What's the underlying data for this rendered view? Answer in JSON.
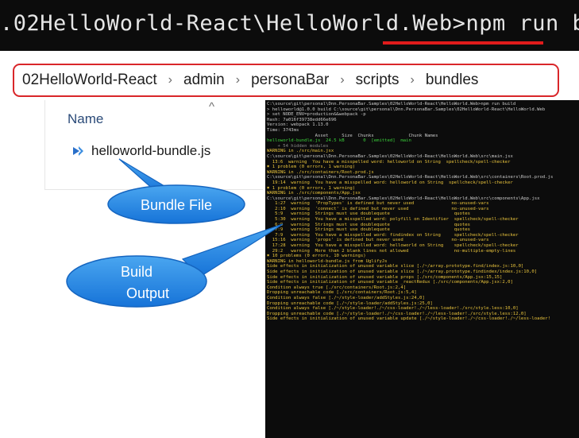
{
  "command": {
    "path": ".02HelloWorld-React\\HelloWorld.Web>",
    "cmd": "npm run build"
  },
  "breadcrumb": [
    "02HelloWorld-React",
    "admin",
    "personaBar",
    "scripts",
    "bundles"
  ],
  "breadcrumb_separator": "›",
  "explorer": {
    "column_header": "Name",
    "sort_caret": "^",
    "file_name": "helloworld-bundle.js"
  },
  "callouts": {
    "bundle_file": "Bundle File",
    "build_output_line1": "Build",
    "build_output_line2": "Output"
  },
  "colors": {
    "callout_fill": "#1e88e5",
    "highlight_red": "#d9262a",
    "terminal_bg": "#0c0c0c"
  },
  "terminal_lines": [
    {
      "t": "C:\\source\\git\\personal\\Dnn.PersonaBar.Samples\\02HelloWorld-React\\HelloWorld.Web>npm run build",
      "c": "w"
    },
    {
      "t": "",
      "c": "w"
    },
    {
      "t": "> helloworld@1.0.0 build C:\\source\\git\\personal\\Dnn.PersonaBar.Samples\\02HelloWorld-React\\HelloWorld.Web",
      "c": "w"
    },
    {
      "t": "> set NODE_ENV=production&&webpack -p",
      "c": "w"
    },
    {
      "t": "",
      "c": "w"
    },
    {
      "t": "Hash: 7a016f39738edd66e696",
      "c": "w"
    },
    {
      "t": "Version: webpack 1.13.0",
      "c": "w"
    },
    {
      "t": "Time: 3743ms",
      "c": "w"
    },
    {
      "t": "                  Asset     Size  Chunks             Chunk Names",
      "c": "w"
    },
    {
      "t": "helloworld-bundle.js  24.5 kB       0  [emitted]  main",
      "c": "g"
    },
    {
      "t": "    + 54 hidden modules",
      "c": "gr"
    },
    {
      "t": "",
      "c": "w"
    },
    {
      "t": "WARNING in ./src/main.jsx",
      "c": "y"
    },
    {
      "t": "",
      "c": "w"
    },
    {
      "t": "C:\\source\\git\\personal\\Dnn.PersonaBar.Samples\\02HelloWorld-React\\HelloWorld.Web\\src\\main.jsx",
      "c": "w"
    },
    {
      "t": "  13:6  warning  You have a misspelled word: helloworld on String  spellcheck/spell-checker",
      "c": "y"
    },
    {
      "t": "",
      "c": "w"
    },
    {
      "t": "✖ 1 problem (0 errors, 1 warning)",
      "c": "y"
    },
    {
      "t": "",
      "c": "w"
    },
    {
      "t": "",
      "c": "w"
    },
    {
      "t": "WARNING in ./src/containers/Root.prod.js",
      "c": "y"
    },
    {
      "t": "",
      "c": "w"
    },
    {
      "t": "C:\\source\\git\\personal\\Dnn.PersonaBar.Samples\\02HelloWorld-React\\HelloWorld.Web\\src\\containers\\Root.prod.js",
      "c": "w"
    },
    {
      "t": "  19:14  warning  You have a misspelled word: helloworld on String  spellcheck/spell-checker",
      "c": "y"
    },
    {
      "t": "",
      "c": "w"
    },
    {
      "t": "✖ 1 problem (0 errors, 1 warning)",
      "c": "y"
    },
    {
      "t": "",
      "c": "w"
    },
    {
      "t": "",
      "c": "w"
    },
    {
      "t": "WARNING in ./src/components/App.jsx",
      "c": "y"
    },
    {
      "t": "",
      "c": "w"
    },
    {
      "t": "C:\\source\\git\\personal\\Dnn.PersonaBar.Samples\\02HelloWorld-React\\HelloWorld.Web\\src\\components\\App.jsx",
      "c": "w"
    },
    {
      "t": "   1:27  warning  'PropTypes' is defined but never used              no-unused-vars",
      "c": "y"
    },
    {
      "t": "   2:10  warning  'connect' is defined but never used                no-unused-vars",
      "c": "y"
    },
    {
      "t": "   5:9   warning  Strings must use doublequote                        quotes",
      "c": "y"
    },
    {
      "t": "   5:30  warning  You have a misspelled word: polyfill on Identifier  spellcheck/spell-checker",
      "c": "y"
    },
    {
      "t": "   6:9   warning  Strings must use doublequote                        quotes",
      "c": "y"
    },
    {
      "t": "   7:9   warning  Strings must use doublequote                        quotes",
      "c": "y"
    },
    {
      "t": "   7:9   warning  You have a misspelled word: findindex on String     spellcheck/spell-checker",
      "c": "y"
    },
    {
      "t": "  15:16  warning  'props' is defined but never used                  no-unused-vars",
      "c": "y"
    },
    {
      "t": "  17:28  warning  You have a misspelled word: helloworld on String    spellcheck/spell-checker",
      "c": "y"
    },
    {
      "t": "  29:2   warning  More than 2 blank lines not allowed                 no-multiple-empty-lines",
      "c": "y"
    },
    {
      "t": "",
      "c": "w"
    },
    {
      "t": "✖ 10 problems (0 errors, 10 warnings)",
      "c": "y"
    },
    {
      "t": "",
      "c": "w"
    },
    {
      "t": "",
      "c": "w"
    },
    {
      "t": "WARNING in helloworld-bundle.js from UglifyJs",
      "c": "y"
    },
    {
      "t": "Side effects in initialization of unused variable slice [./~/array.prototype.find/index.js:10,0]",
      "c": "y"
    },
    {
      "t": "Side effects in initialization of unused variable slice [./~/array.prototype.findindex/index.js:10,0]",
      "c": "y"
    },
    {
      "t": "Side effects in initialization of unused variable props [./src/components/App.jsx:15,15]",
      "c": "y"
    },
    {
      "t": "Side effects in initialization of unused variable _reactRedux [./src/components/App.jsx:2,0]",
      "c": "y"
    },
    {
      "t": "Condition always true [./src/containers/Root.js:2,4]",
      "c": "y"
    },
    {
      "t": "Dropping unreachable code [./src/containers/Root.js:5,4]",
      "c": "y"
    },
    {
      "t": "Condition always false [./~/style-loader/addStyles.js:24,0]",
      "c": "y"
    },
    {
      "t": "Dropping unreachable code [./~/style-loader/addStyles.js:25,0]",
      "c": "y"
    },
    {
      "t": "Condition always false [./~/style-loader!./~/css-loader!./~/less-loader!./src/style.less:10,0]",
      "c": "y"
    },
    {
      "t": "Dropping unreachable code [./~/style-loader!./~/css-loader!./~/less-loader!./src/style.less:12,0]",
      "c": "y"
    },
    {
      "t": "Side effects in initialization of unused variable update [./~/style-loader!./~/css-loader!./~/less-loader!",
      "c": "y"
    }
  ]
}
